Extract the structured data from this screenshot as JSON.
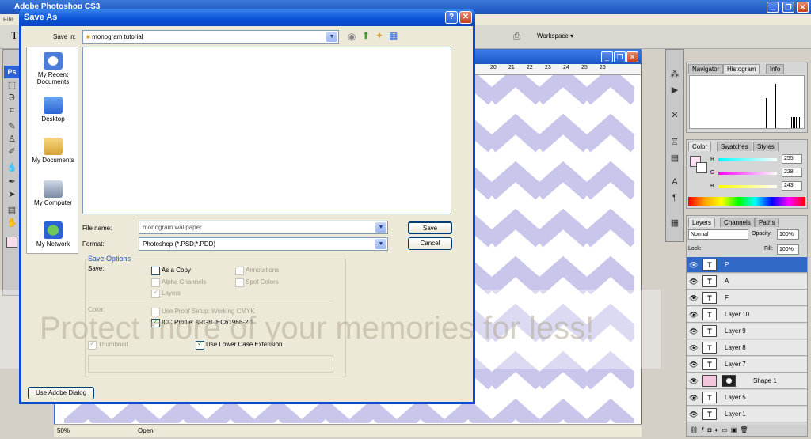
{
  "app": {
    "title": "Adobe Photoshop CS3",
    "menu_first": "File",
    "workspace_label": "Workspace ▾"
  },
  "document": {
    "ruler_ticks": [
      "20",
      "21",
      "22",
      "23",
      "24",
      "25",
      "26"
    ],
    "zoom": "50%",
    "status_text": "Open"
  },
  "panels": {
    "nav_tabs": [
      "Navigator",
      "Histogram",
      "Info"
    ],
    "color_tabs": [
      "Color",
      "Swatches",
      "Styles"
    ],
    "rgb": {
      "r_label": "R",
      "g_label": "G",
      "b_label": "B",
      "r": "255",
      "g": "228",
      "b": "243"
    },
    "layers_tabs": [
      "Layers",
      "Channels",
      "Paths"
    ],
    "blend_mode": "Normal",
    "opacity_label": "Opacity:",
    "opacity": "100%",
    "lock_label": "Lock:",
    "fill_label": "Fill:",
    "fill": "100%",
    "layers": [
      {
        "name": "P",
        "thumb": "T",
        "selected": true
      },
      {
        "name": "A",
        "thumb": "T"
      },
      {
        "name": "F",
        "thumb": "T"
      },
      {
        "name": "Layer 10",
        "thumb": "T"
      },
      {
        "name": "Layer 9",
        "thumb": "T"
      },
      {
        "name": "Layer 8",
        "thumb": "T"
      },
      {
        "name": "Layer 7",
        "thumb": "T"
      },
      {
        "name": "Shape 1",
        "thumb": ""
      },
      {
        "name": "Layer 5",
        "thumb": "T"
      },
      {
        "name": "Layer 1",
        "thumb": "T"
      }
    ]
  },
  "dialog": {
    "title": "Save As",
    "save_in_label": "Save in:",
    "save_in_value": "monogram tutorial",
    "places": [
      "My Recent Documents",
      "Desktop",
      "My Documents",
      "My Computer",
      "My Network"
    ],
    "file_name_label": "File name:",
    "file_name_value": "monogram wallpaper",
    "format_label": "Format:",
    "format_value": "Photoshop (*.PSD;*.PDD)",
    "save_button": "Save",
    "cancel_button": "Cancel",
    "save_options_heading": "Save Options",
    "save_label": "Save:",
    "as_a_copy": "As a Copy",
    "annotations": "Annotations",
    "alpha_channels": "Alpha Channels",
    "spot_colors": "Spot Colors",
    "layers": "Layers",
    "color_label": "Color:",
    "use_proof_setup": "Use Proof Setup:  Working CMYK",
    "icc_profile": "ICC Profile:  sRGB IEC61966-2.1",
    "thumbnail": "Thumbnail",
    "lower_case_ext": "Use Lower Case Extension",
    "adobe_dialog_button": "Use Adobe Dialog"
  },
  "watermark": {
    "text": "Protect more of your memories for less!"
  },
  "colors": {
    "chevron": "#c9c6ec",
    "xp_blue": "#0a52d6",
    "selected_layer": "#3169c6"
  }
}
